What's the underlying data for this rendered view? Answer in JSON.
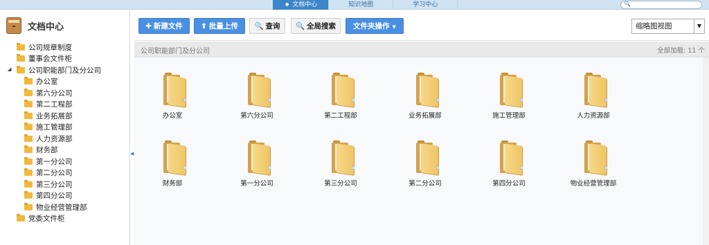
{
  "topnav": {
    "items": [
      {
        "label": "文档中心",
        "active": true
      },
      {
        "label": "知识地图",
        "active": false
      },
      {
        "label": "学习中心",
        "active": false
      }
    ],
    "search_placeholder": ""
  },
  "sidebar": {
    "title": "文档中心",
    "tree": [
      {
        "label": "公司规章制度",
        "level": 1
      },
      {
        "label": "董事会文件柜",
        "level": 1
      },
      {
        "label": "公司职能部门及分公司",
        "level": 1,
        "expanded": true
      },
      {
        "label": "办公室",
        "level": 2
      },
      {
        "label": "第六分公司",
        "level": 2
      },
      {
        "label": "第二工程部",
        "level": 2
      },
      {
        "label": "业务拓展部",
        "level": 2
      },
      {
        "label": "施工管理部",
        "level": 2
      },
      {
        "label": "人力资源部",
        "level": 2
      },
      {
        "label": "财务部",
        "level": 2
      },
      {
        "label": "第一分公司",
        "level": 2
      },
      {
        "label": "第二分公司",
        "level": 2
      },
      {
        "label": "第三分公司",
        "level": 2
      },
      {
        "label": "第四分公司",
        "level": 2
      },
      {
        "label": "物业经营管理部",
        "level": 2
      },
      {
        "label": "党委文件柜",
        "level": 1
      }
    ]
  },
  "toolbar": {
    "new_doc": "新建文件",
    "batch_upload": "批量上传",
    "query": "查询",
    "global_search": "全局搜索",
    "folder_ops": "文件夹操作",
    "view_mode": "缩略图视图"
  },
  "pathbar": {
    "path": "公司职能部门及分公司",
    "meta": "全部加载: 11 个"
  },
  "folders": [
    "办公室",
    "第六分公司",
    "第二工程部",
    "业务拓展部",
    "施工管理部",
    "人力资源部",
    "财务部",
    "第一分公司",
    "第三分公司",
    "第二分公司",
    "第四分公司",
    "物业经营管理部"
  ],
  "colors": {
    "accent_blue": "#4a90e2",
    "topbar": "#cfe3f2",
    "folder": "#f0b93d"
  }
}
